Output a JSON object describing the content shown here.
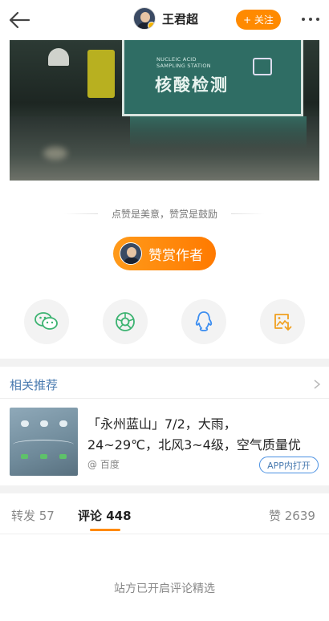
{
  "header": {
    "author_name": "王君超",
    "follow_label": "+ 关注"
  },
  "photo": {
    "booth_text_en_line1": "NUCLEIC ACID",
    "booth_text_en_line2": "SAMPLING STATION",
    "booth_text_cn": "核酸检测"
  },
  "reward": {
    "hint": "点赞是美意，赞赏是鼓励",
    "button_label": "赞赏作者"
  },
  "share": {
    "items": [
      {
        "name": "wechat-icon"
      },
      {
        "name": "moments-icon"
      },
      {
        "name": "qq-icon"
      },
      {
        "name": "save-image-icon"
      }
    ]
  },
  "related": {
    "title": "相关推荐",
    "item": {
      "text_line1": "「永州蓝山」7/2，大雨，",
      "text_line2": "24~29℃，北风3~4级，空气质量优",
      "source": "@ 百度",
      "open_in_app": "APP内打开"
    }
  },
  "tabs": {
    "repost": "转发 57",
    "comments": "评论 448",
    "likes": "赞 2639"
  },
  "comments": {
    "notice": "站方已开启评论精选"
  },
  "colors": {
    "accent": "#ff8a00",
    "link_blue": "#4a7bb0"
  }
}
